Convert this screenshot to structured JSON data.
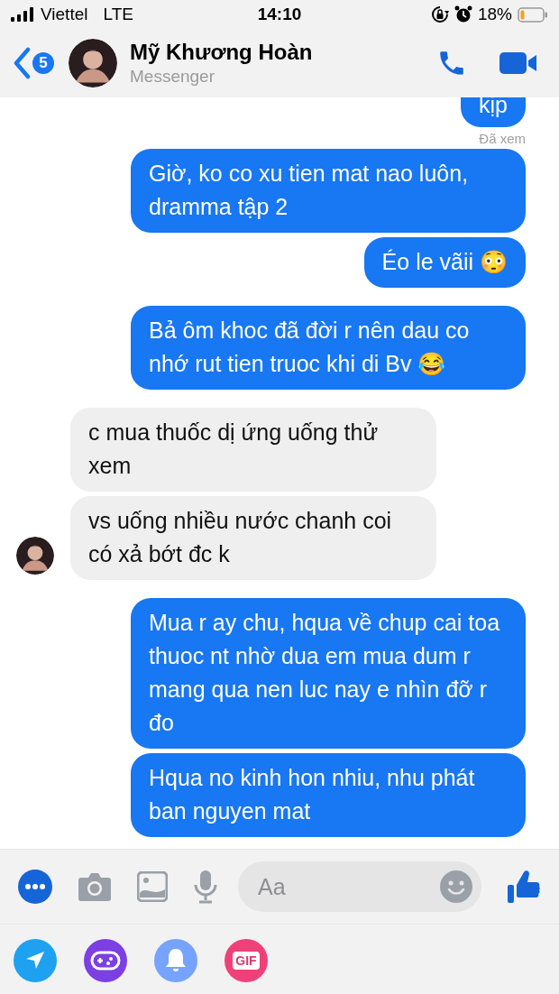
{
  "status_bar": {
    "carrier": "Viettel",
    "network": "LTE",
    "time": "14:10",
    "battery": "18%"
  },
  "header": {
    "unread_count": "5",
    "name": "Mỹ Khương Hoàn",
    "subtitle": "Messenger"
  },
  "messages": [
    {
      "kind": "sent",
      "text": "kịp"
    },
    {
      "kind": "receipt",
      "text": "Đã xem"
    },
    {
      "kind": "sent",
      "text": "Giờ, ko co xu tien mat nao luôn, dramma tập 2"
    },
    {
      "kind": "sent",
      "text": "Éo le vãii 😳"
    },
    {
      "kind": "sent",
      "text": "Bả ôm khoc đã đời r nên dau co nhớ rut tien truoc khi di Bv 😂"
    },
    {
      "kind": "received",
      "text": "c mua thuốc dị ứng uống thử xem"
    },
    {
      "kind": "received",
      "text": "vs uống nhiều nước chanh coi có xả bớt đc k"
    },
    {
      "kind": "sent",
      "text": "Mua r ay chu, hqua về chup cai toa thuoc nt nhờ dua em mua dum r mang qua nen luc nay e nhìn đỡ r đo"
    },
    {
      "kind": "sent",
      "text": "Hqua no kinh hon nhiu, nhu phát ban nguyen mat"
    }
  ],
  "composer": {
    "placeholder": "Aa"
  },
  "app_tray": [
    {
      "kind": "send"
    },
    {
      "kind": "game"
    },
    {
      "kind": "bell"
    },
    {
      "kind": "gif",
      "label": "GIF"
    }
  ]
}
